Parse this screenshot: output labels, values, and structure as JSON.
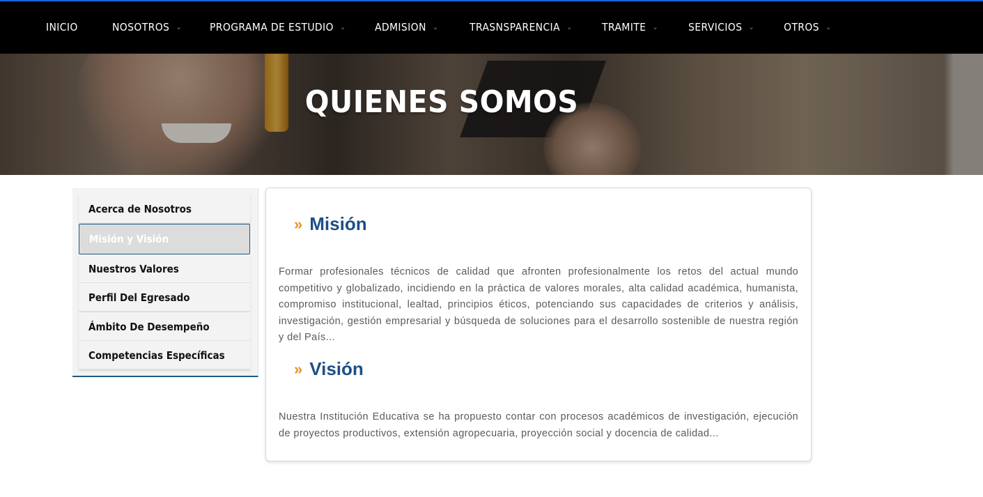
{
  "nav": {
    "items": [
      {
        "label": "INICIO",
        "has_dropdown": false
      },
      {
        "label": "NOSOTROS",
        "has_dropdown": true
      },
      {
        "label": "PROGRAMA DE ESTUDIO",
        "has_dropdown": true
      },
      {
        "label": "ADMISION",
        "has_dropdown": true
      },
      {
        "label": "TRASNSPARENCIA",
        "has_dropdown": true
      },
      {
        "label": "TRAMITE",
        "has_dropdown": true
      },
      {
        "label": "SERVICIOS",
        "has_dropdown": true
      },
      {
        "label": "OTROS",
        "has_dropdown": true
      }
    ],
    "dropdown_icon": "chevron-down-icon"
  },
  "hero": {
    "title": "QUIENES SOMOS"
  },
  "sidebar": {
    "items": [
      {
        "label": "Acerca de Nosotros",
        "active": false
      },
      {
        "label": "Misión y Visión",
        "active": true
      },
      {
        "label": "Nuestros Valores",
        "active": false
      },
      {
        "label": "Perfil Del Egresado",
        "active": false
      },
      {
        "label": "Ámbito De Desempeño",
        "active": false
      },
      {
        "label": "Competencias Específicas",
        "active": false
      }
    ]
  },
  "content": {
    "bullet": "»",
    "mision": {
      "title": "Misión",
      "text": "Formar profesionales técnicos de calidad que afronten profesionalmente los retos del actual mundo competitivo y globalizado, incidiendo en la práctica de valores morales, alta calidad académica, humanista, compromiso institucional, lealtad, principios éticos, potenciando sus capacidades de criterios y análisis, investigación, gestión empresarial y búsqueda de soluciones para el desarrollo sostenible de nuestra región y del País..."
    },
    "vision": {
      "title": "Visión",
      "text": "Nuestra Institución Educativa se ha propuesto contar con procesos académicos de investigación, ejecución de proyectos productivos, extensión agropecuaria, proyección social y docencia de calidad..."
    }
  },
  "colors": {
    "nav_bg": "#000000",
    "nav_top_border": "#1565e0",
    "heading_blue": "#1d4f86",
    "bullet_orange": "#e8952a",
    "active_border": "#1b5a86"
  }
}
